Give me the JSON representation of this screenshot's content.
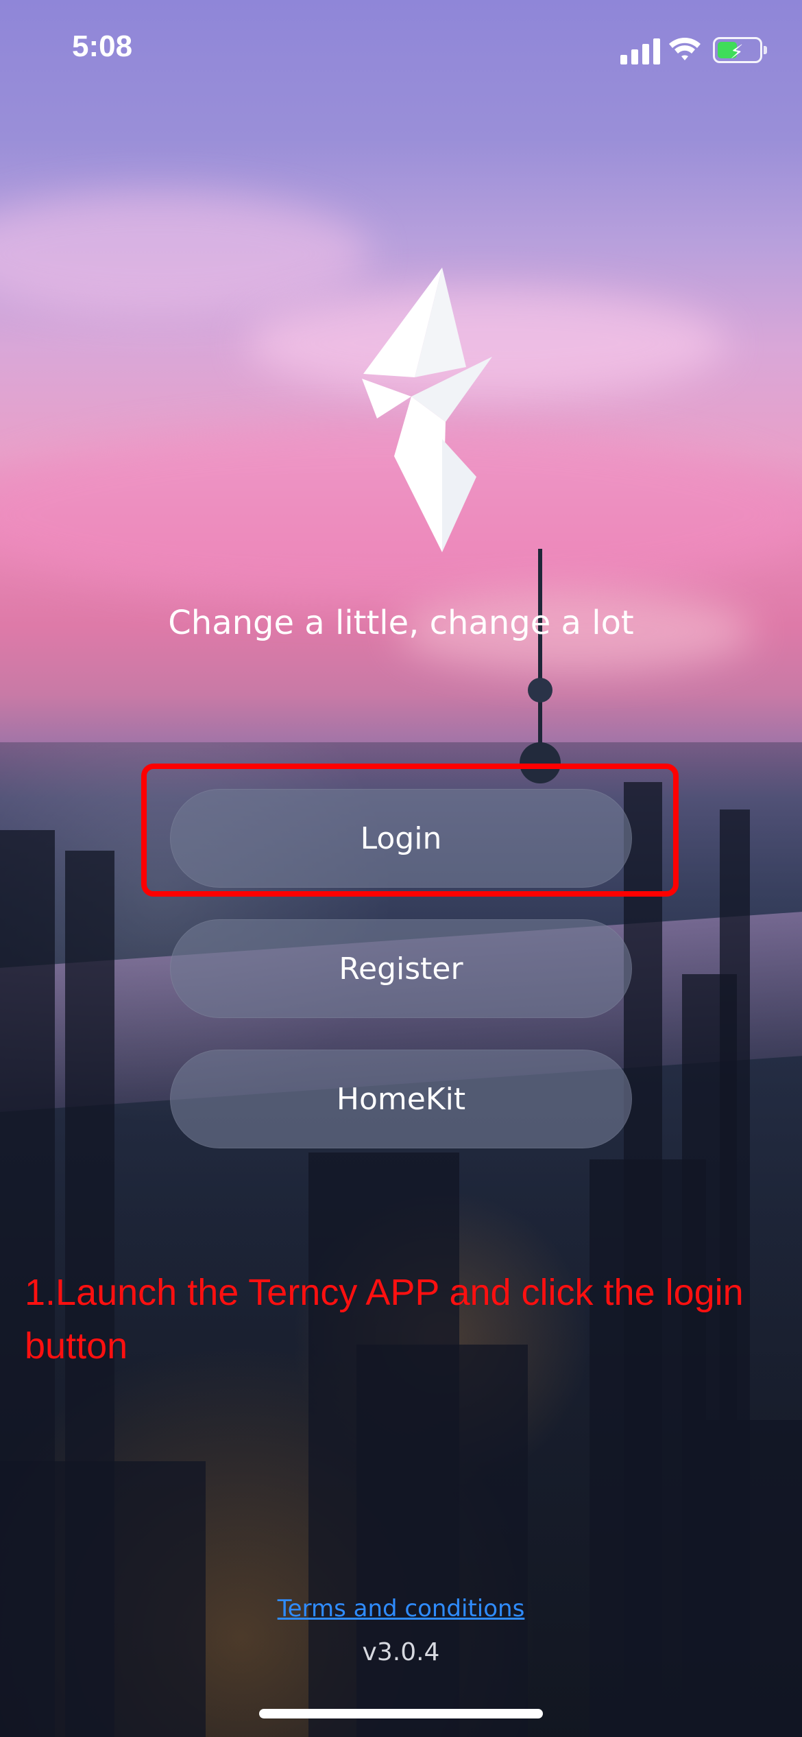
{
  "status_bar": {
    "time": "5:08",
    "signal_icon": "cellular-signal-icon",
    "wifi_icon": "wifi-icon",
    "battery_icon": "battery-charging-icon"
  },
  "branding": {
    "logo_icon": "bird-logo-icon",
    "tagline": "Change a little, change a lot"
  },
  "buttons": {
    "login": "Login",
    "register": "Register",
    "homekit": "HomeKit"
  },
  "annotation": {
    "text": "1.Launch the Terncy APP and click the login button"
  },
  "footer": {
    "terms": "Terms and conditions",
    "version": "v3.0.4"
  },
  "colors": {
    "highlight": "#ff0000",
    "annotation": "#ff1010",
    "link": "#2f8cff",
    "battery": "#3fdc5a"
  }
}
